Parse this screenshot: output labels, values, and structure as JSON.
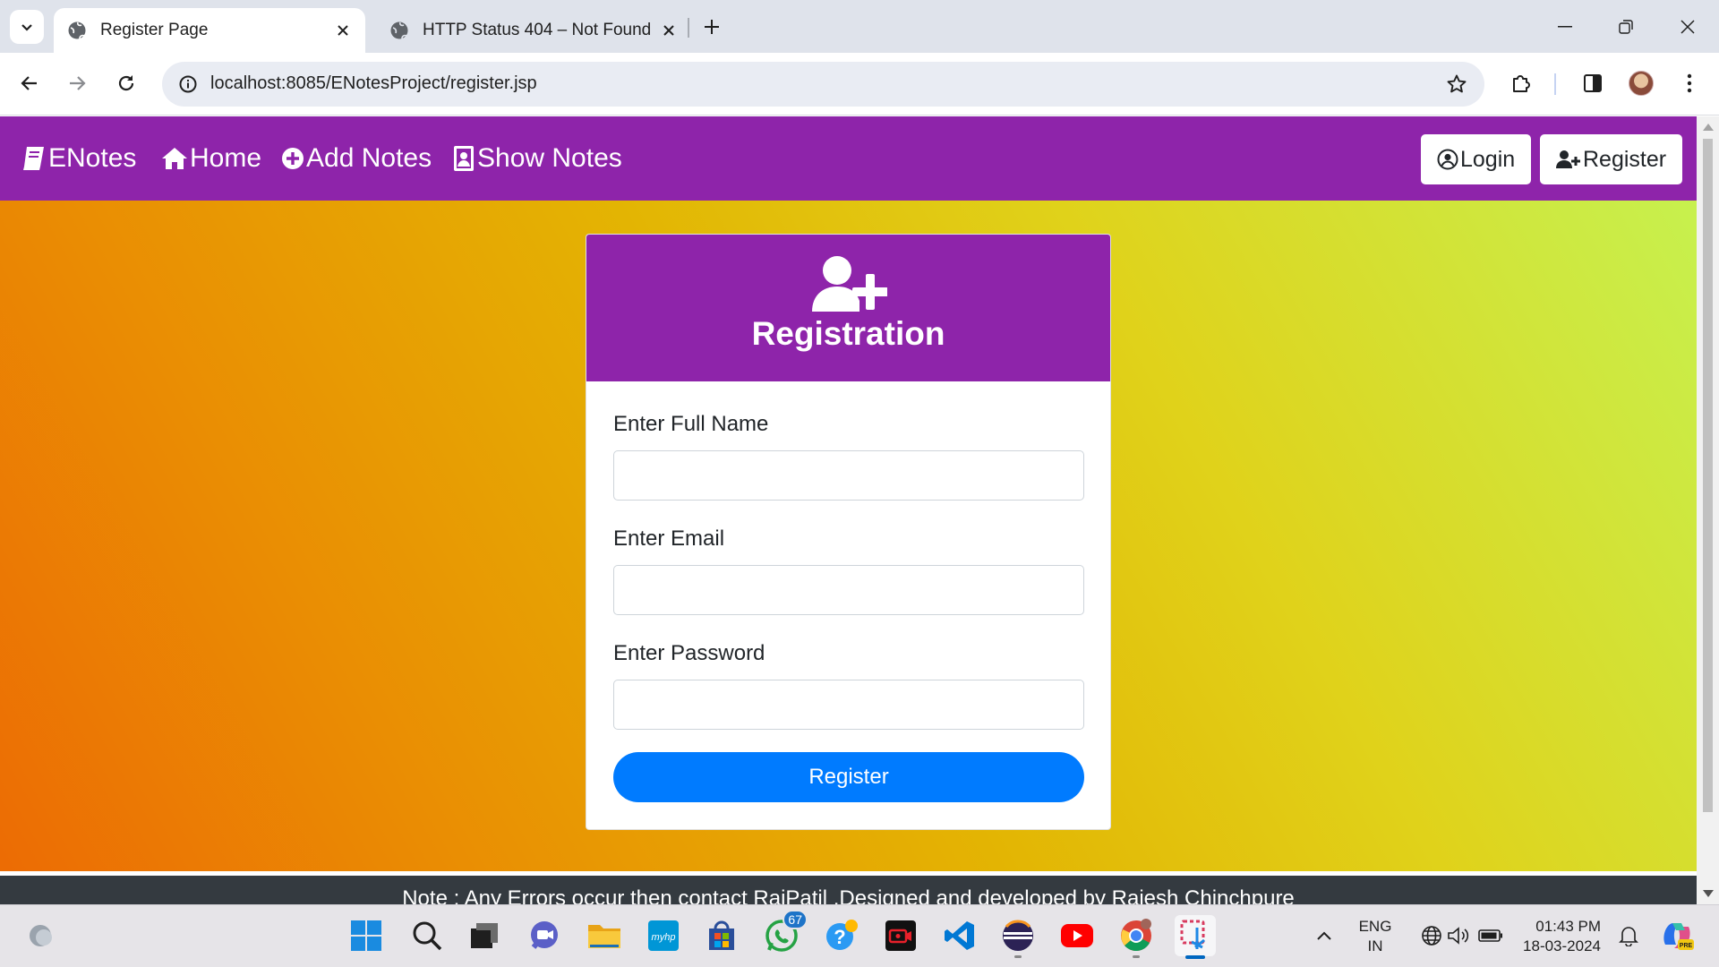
{
  "browser": {
    "tabs": [
      {
        "title": "Register Page",
        "active": true
      },
      {
        "title": "HTTP Status 404 – Not Found",
        "active": false
      }
    ],
    "url": "localhost:8085/ENotesProject/register.jsp"
  },
  "navbar": {
    "brand": "ENotes",
    "links": [
      "Home",
      "Add Notes",
      "Show Notes"
    ],
    "login_label": "Login",
    "register_label": "Register",
    "color": "#8e24aa"
  },
  "form": {
    "title": "Registration",
    "name_label": "Enter Full Name",
    "email_label": "Enter Email",
    "password_label": "Enter Password",
    "submit_label": "Register",
    "submit_color": "#007bff"
  },
  "footer": {
    "text": "Note : Any Errors occur then contact RajPatil ,Designed and developed by Rajesh Chinchpure"
  },
  "taskbar": {
    "whatsapp_badge": "67",
    "language_top": "ENG",
    "language_bottom": "IN",
    "time": "01:43 PM",
    "date": "18-03-2024"
  }
}
